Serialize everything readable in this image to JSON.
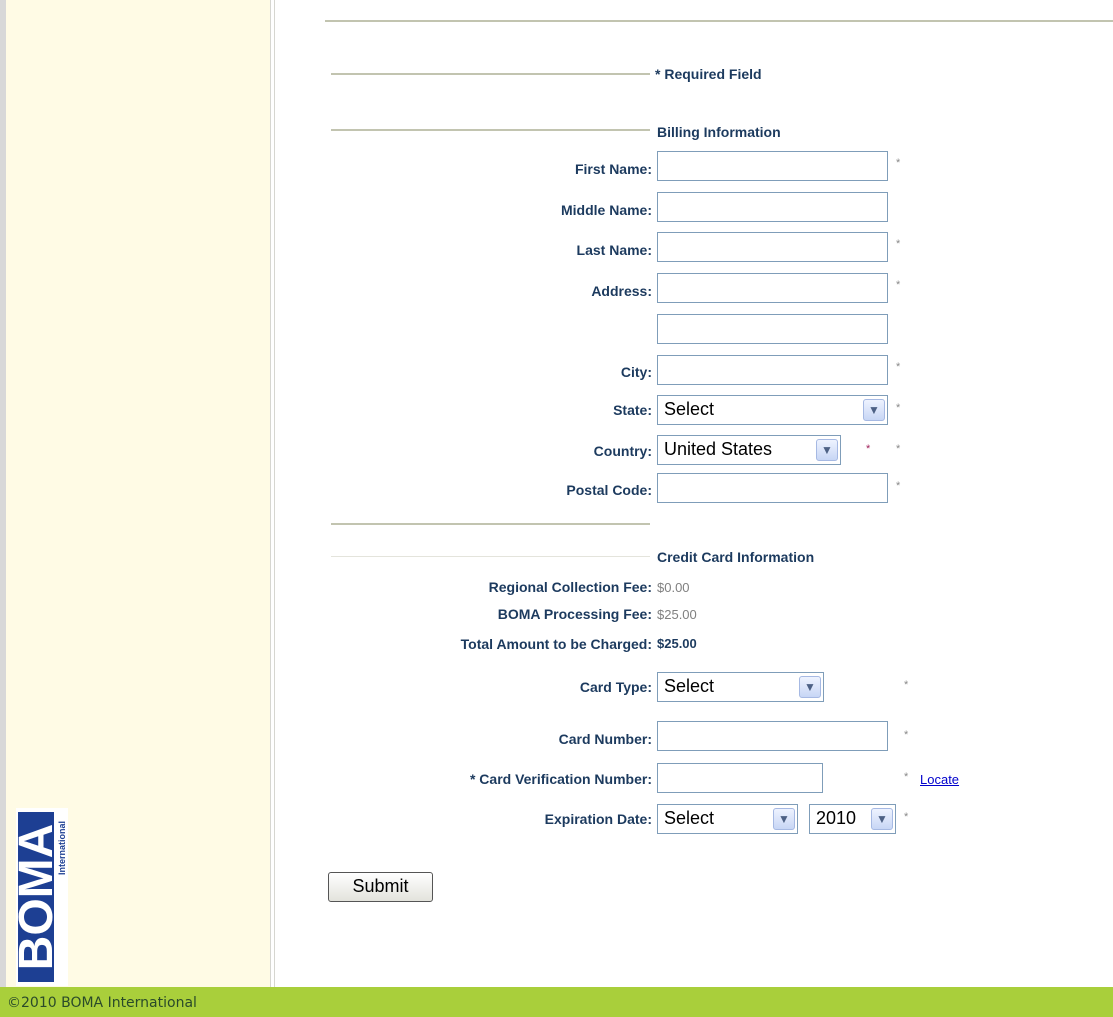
{
  "required_note": "* Required Field",
  "billing": {
    "heading": "Billing Information",
    "first_name": "First Name:",
    "middle_name": "Middle Name:",
    "last_name": "Last Name:",
    "address": "Address:",
    "city": "City:",
    "state": "State:",
    "state_value": "Select",
    "country": "Country:",
    "country_value": "United States",
    "postal_code": "Postal Code:",
    "asterisk": "*"
  },
  "credit": {
    "heading": "Credit Card Information",
    "regional_fee_label": "Regional Collection Fee:",
    "regional_fee_value": "$0.00",
    "processing_fee_label": "BOMA Processing Fee:",
    "processing_fee_value": "$25.00",
    "total_label": "Total Amount to be Charged:",
    "total_value": "$25.00",
    "card_type": "Card Type:",
    "card_type_value": "Select",
    "card_number": "Card Number:",
    "cvn": "* Card Verification Number:",
    "locate": "Locate",
    "expiration": "Expiration Date:",
    "exp_month_value": "Select",
    "exp_year_value": "2010"
  },
  "submit_label": "Submit",
  "footer": "©2010 BOMA International",
  "logo_text": "BOMA",
  "logo_sub": "International",
  "colors": {
    "footer_bg": "#a9cf3b",
    "sidebar_bg": "#fffbe5",
    "label_blue": "#1c3a5e"
  }
}
